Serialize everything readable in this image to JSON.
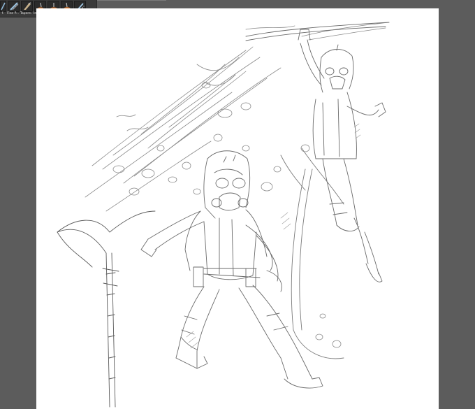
{
  "toolbar": {
    "brushes": [
      {
        "label": "f.",
        "icon": "brush-stroke-icon",
        "color": "#8fb8d8"
      },
      {
        "label": "Fine P...",
        "icon": "fine-pencil-icon",
        "color": "#9fc6e4"
      },
      {
        "label": "Tapere...",
        "icon": "tapered-brush-icon",
        "color": "#c7b08a"
      },
      {
        "label": "Impres...",
        "icon": "impressionist-brush-icon",
        "color": "#d0722e"
      },
      {
        "label": "Sargen...",
        "icon": "sargent-brush-icon",
        "color": "#d0722e"
      },
      {
        "label": "Van Go...",
        "icon": "van-gogh-brush-icon",
        "color": "#d0722e"
      },
      {
        "label": "Spatte...",
        "icon": "spatter-brush-icon",
        "color": "#9fc6e4"
      }
    ]
  },
  "canvas": {
    "background": "#ffffff",
    "artwork": "pencil-sketch-artwork"
  },
  "workspace": {
    "background": "#5c5c5c"
  }
}
